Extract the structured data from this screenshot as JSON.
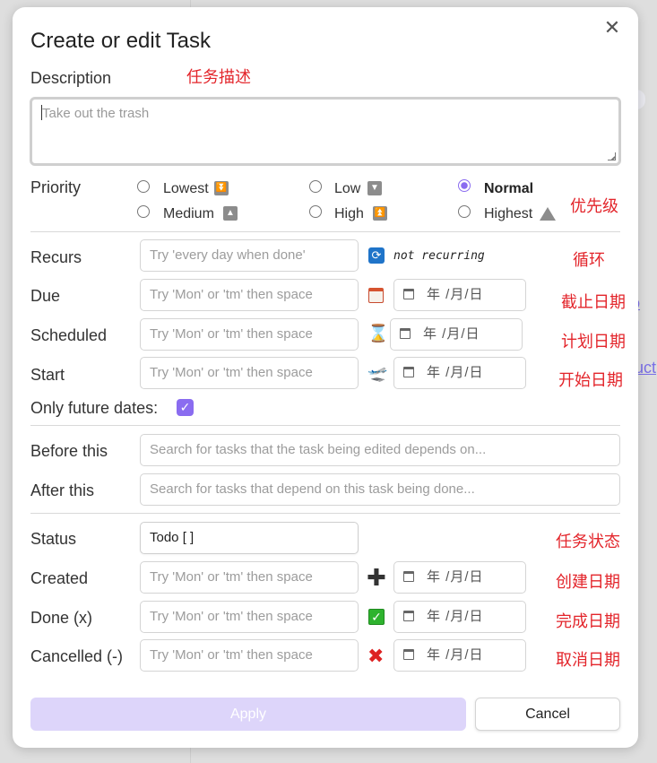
{
  "modal": {
    "title": "Create or edit Task",
    "close_glyph": "✕",
    "description": {
      "label": "Description",
      "annotation": "任务描述",
      "placeholder": "Take out the trash"
    },
    "priority": {
      "label": "Priority",
      "annotation": "优先级",
      "selected": "Normal",
      "options": [
        {
          "label": "Lowest",
          "icon": "lowest-priority-icon"
        },
        {
          "label": "Low",
          "icon": "low-priority-icon"
        },
        {
          "label": "Normal",
          "icon": null
        },
        {
          "label": "Medium",
          "icon": "medium-priority-icon"
        },
        {
          "label": "High",
          "icon": "high-priority-icon"
        },
        {
          "label": "Highest",
          "icon": "highest-priority-icon"
        }
      ]
    },
    "recurs": {
      "label": "Recurs",
      "placeholder": "Try 'every day when done'",
      "value_text": "not recurring",
      "annotation": "循环"
    },
    "due": {
      "label": "Due",
      "placeholder": "Try 'Mon' or 'tm' then space",
      "date_text": "年 /月/日",
      "annotation": "截止日期"
    },
    "scheduled": {
      "label": "Scheduled",
      "placeholder": "Try 'Mon' or 'tm' then space",
      "date_text": "年 /月/日",
      "annotation": "计划日期"
    },
    "start": {
      "label": "Start",
      "placeholder": "Try 'Mon' or 'tm' then space",
      "date_text": "年 /月/日",
      "annotation": "开始日期"
    },
    "only_future": {
      "label": "Only future dates:",
      "checked": true
    },
    "before_this": {
      "label": "Before this",
      "placeholder": "Search for tasks that the task being edited depends on..."
    },
    "after_this": {
      "label": "After this",
      "placeholder": "Search for tasks that depend on this task being done..."
    },
    "status": {
      "label": "Status",
      "value": "Todo [ ]",
      "annotation": "任务状态"
    },
    "created": {
      "label": "Created",
      "placeholder": "Try 'Mon' or 'tm' then space",
      "date_text": "年 /月/日",
      "annotation": "创建日期"
    },
    "done": {
      "label": "Done (x)",
      "placeholder": "Try 'Mon' or 'tm' then space",
      "date_text": "年 /月/日",
      "annotation": "完成日期"
    },
    "cancelled": {
      "label": "Cancelled (-)",
      "placeholder": "Try 'Mon' or 'tm' then space",
      "date_text": "年 /月/日",
      "annotation": "取消日期"
    },
    "buttons": {
      "apply": "Apply",
      "cancel": "Cancel"
    }
  },
  "background": {
    "link_fragment_1": "o",
    "link_fragment_2": "uct"
  },
  "colors": {
    "accent": "#8a6cf0",
    "apply_disabled": "#ddd5fa",
    "annotation": "#e3252b"
  }
}
